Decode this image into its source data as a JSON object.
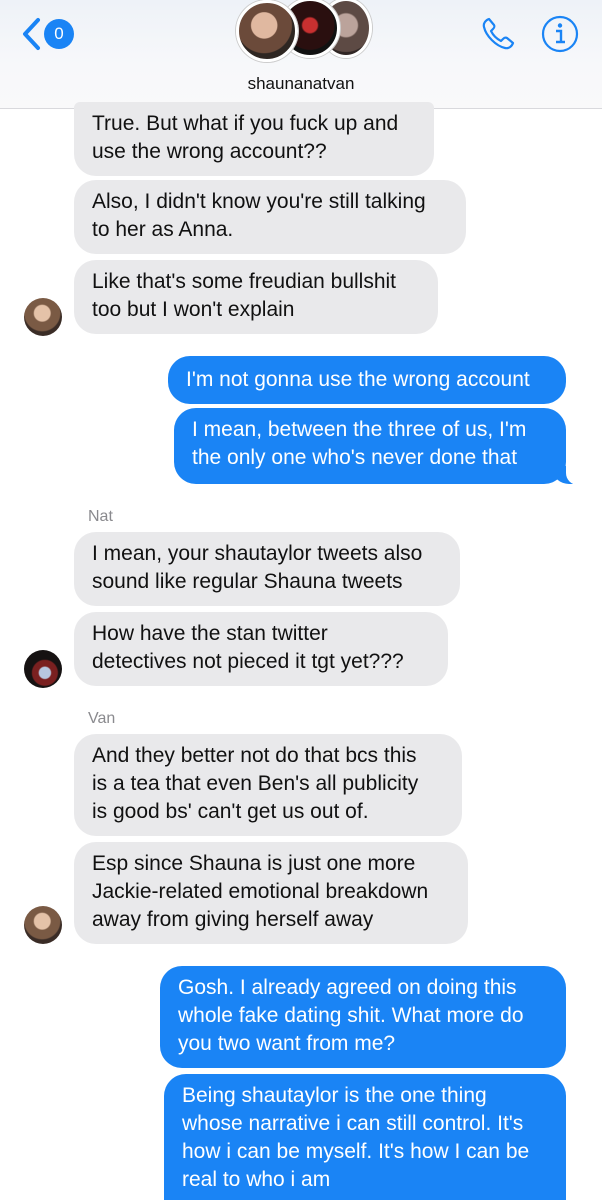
{
  "header": {
    "back_count": "0",
    "conversation_title": "shaunanatvan"
  },
  "messages": [
    {
      "text": "True. But what if you fuck up and\nuse the wrong account??"
    },
    {
      "text": "Also, I didn't know you're still talking\nto her as Anna."
    },
    {
      "text": "Like that's some freudian bullshit\ntoo but I won't explain"
    },
    {
      "text": "I'm not gonna use the wrong account"
    },
    {
      "text": "I mean, between the three of us, I'm\nthe only one who's never done that"
    },
    {
      "text": "I mean, your shautaylor tweets also\nsound like regular Shauna tweets"
    },
    {
      "text": "How have the stan twitter\ndetectives not pieced it tgt yet???"
    },
    {
      "text": "And they better not do that bcs this\nis a tea that even Ben's all publicity\nis good bs' can't get us out of."
    },
    {
      "text": "Esp since Shauna is just one more\nJackie-related emotional breakdown\naway from giving herself away"
    },
    {
      "text": "Gosh. I already agreed on doing this\nwhole fake dating shit. What more do\nyou two want from me?"
    },
    {
      "text": "Being shautaylor is the one thing\nwhose narrative i can still control. It's\nhow i can be myself. It's how I can be\nreal to who i am"
    }
  ],
  "senders": {
    "nat": "Nat",
    "van": "Van"
  },
  "colors": {
    "outgoing_bubble": "#1a84f5",
    "incoming_bubble": "#e9e9eb",
    "accent": "#1a84f5"
  }
}
